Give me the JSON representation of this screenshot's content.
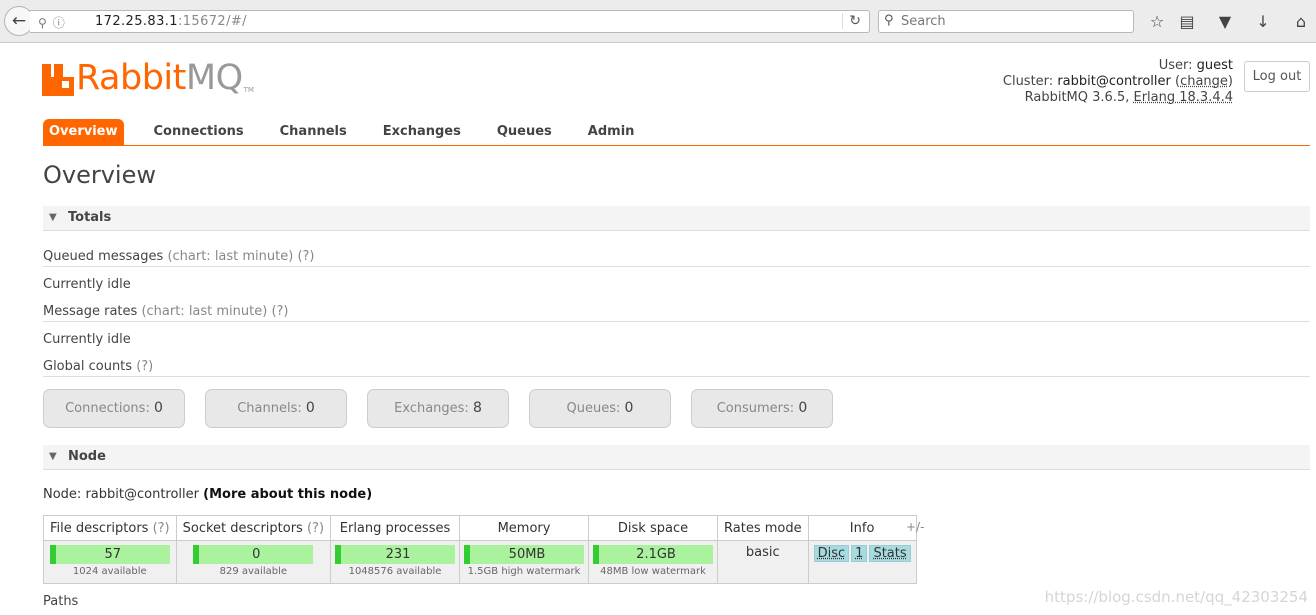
{
  "browser": {
    "url_host": "172.25.83.1",
    "url_rest": ":15672/#/",
    "search_placeholder": "Search"
  },
  "logo": {
    "part1": "Rabbit",
    "part2": "MQ",
    "tm": "TM"
  },
  "header": {
    "user_label": "User:",
    "user": "guest",
    "cluster_label": "Cluster:",
    "cluster": "rabbit@controller",
    "change_link": "change",
    "version": "RabbitMQ 3.6.5,",
    "erlang": "Erlang 18.3.4.4",
    "logout": "Log out"
  },
  "tabs": [
    "Overview",
    "Connections",
    "Channels",
    "Exchanges",
    "Queues",
    "Admin"
  ],
  "page_title": "Overview",
  "totals": {
    "heading": "Totals",
    "queued_label": "Queued messages",
    "queued_hint": "(chart: last minute) (?)",
    "idle1": "Currently idle",
    "rates_label": "Message rates",
    "rates_hint": "(chart: last minute) (?)",
    "idle2": "Currently idle",
    "global_label": "Global counts",
    "global_hint": "(?)",
    "counts": [
      {
        "label": "Connections:",
        "value": "0"
      },
      {
        "label": "Channels:",
        "value": "0"
      },
      {
        "label": "Exchanges:",
        "value": "8"
      },
      {
        "label": "Queues:",
        "value": "0"
      },
      {
        "label": "Consumers:",
        "value": "0"
      }
    ]
  },
  "node": {
    "heading": "Node",
    "node_label": "Node:",
    "node_name": "rabbit@controller",
    "more_link": "(More about this node)",
    "headers": {
      "fd": "File descriptors",
      "sd": "Socket descriptors",
      "ep": "Erlang processes",
      "mem": "Memory",
      "disk": "Disk space",
      "rates": "Rates mode",
      "info": "Info",
      "hint": "(?)"
    },
    "fd_value": "57",
    "fd_sub": "1024 available",
    "sd_value": "0",
    "sd_sub": "829 available",
    "ep_value": "231",
    "ep_sub": "1048576 available",
    "mem_value": "50MB",
    "mem_sub": "1.5GB high watermark",
    "disk_value": "2.1GB",
    "disk_sub": "48MB low watermark",
    "rates_mode": "basic",
    "info_badges": [
      "Disc",
      "1",
      "Stats"
    ],
    "plusminus": "+/-"
  },
  "paths_label": "Paths",
  "watermark": "https://blog.csdn.net/qq_42303254"
}
